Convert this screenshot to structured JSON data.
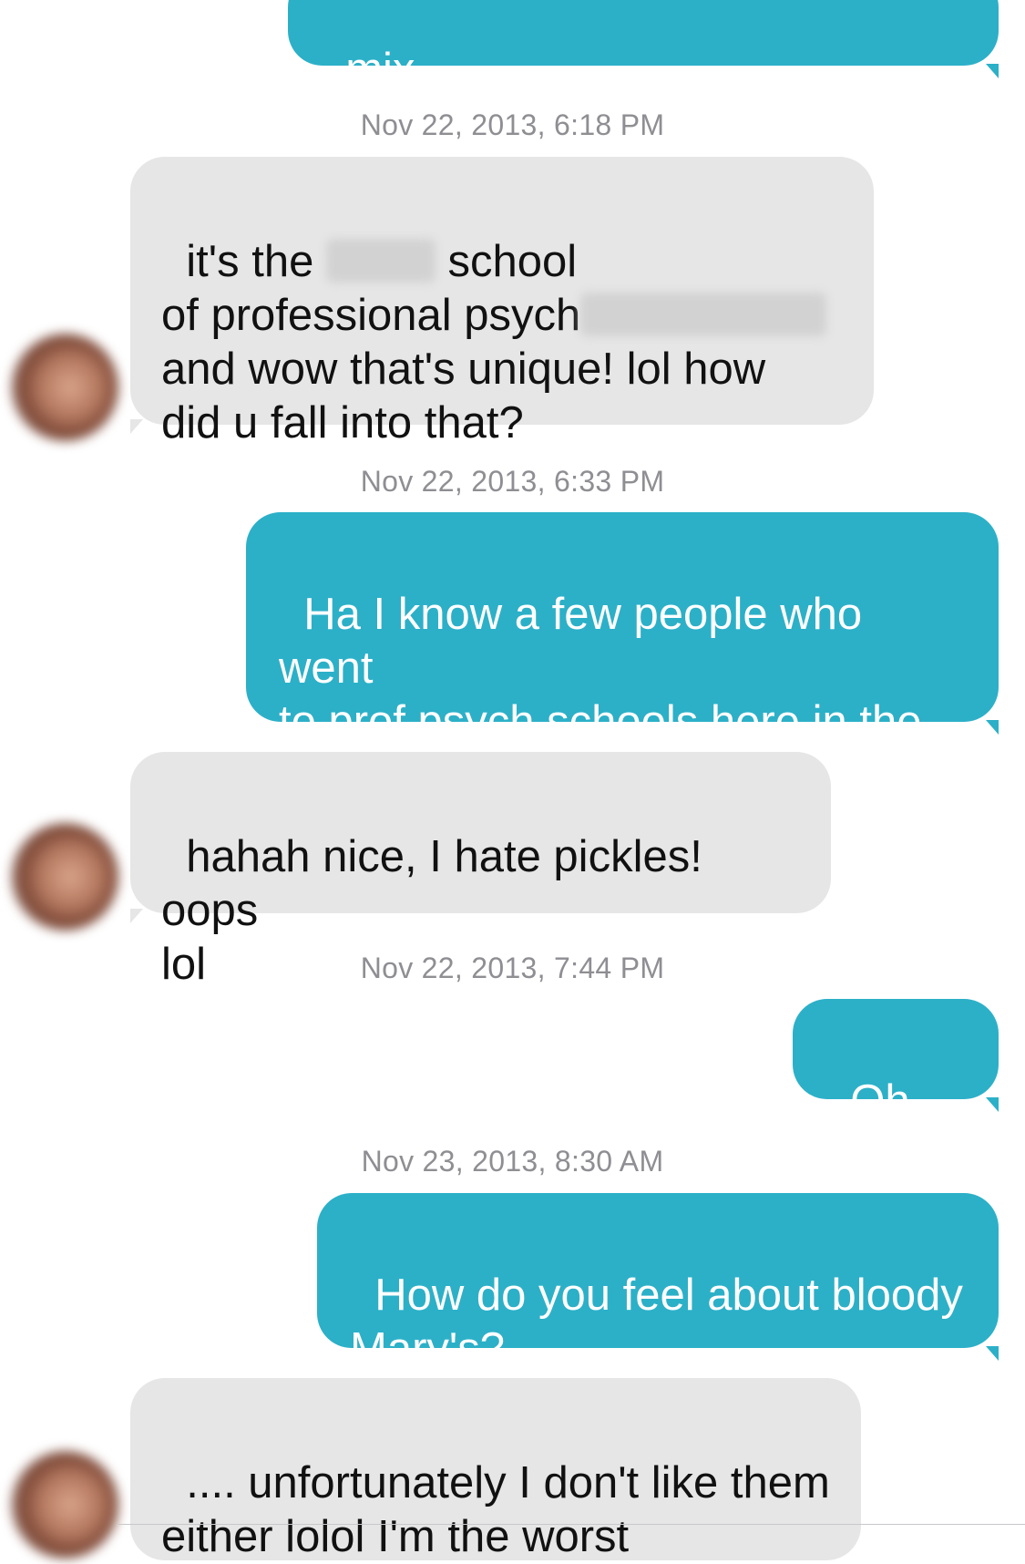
{
  "thread": {
    "colors": {
      "incoming_bubble": "#e6e6e6",
      "outgoing_bubble": "#2cb0c8",
      "timestamp": "#8e8e93"
    },
    "items": [
      {
        "kind": "message",
        "direction": "outgoing",
        "text": "mix."
      },
      {
        "kind": "timestamp",
        "text": "Nov 22, 2013, 6:18 PM"
      },
      {
        "kind": "message",
        "direction": "incoming",
        "avatar": "blurred-contact-photo",
        "parts": [
          "it's the ",
          " school\nof professional psych",
          "\nand wow that's unique! lol how\ndid u fall into that?"
        ]
      },
      {
        "kind": "timestamp",
        "text": "Nov 22, 2013, 6:33 PM"
      },
      {
        "kind": "message",
        "direction": "outgoing",
        "text": "Ha I know a few people who went\nto prof psych schools here in the\ncity!  I love pickles :)"
      },
      {
        "kind": "message",
        "direction": "incoming",
        "avatar": "blurred-contact-photo",
        "text": "hahah nice, I hate pickles! oops\nlol"
      },
      {
        "kind": "timestamp",
        "text": "Nov 22, 2013, 7:44 PM"
      },
      {
        "kind": "message",
        "direction": "outgoing",
        "text": "Oh no!"
      },
      {
        "kind": "timestamp",
        "text": "Nov 23, 2013, 8:30 AM"
      },
      {
        "kind": "message",
        "direction": "outgoing",
        "text": "How do you feel about bloody\nMary's?"
      },
      {
        "kind": "message",
        "direction": "incoming",
        "avatar": "blurred-contact-photo",
        "text": ".... unfortunately I don't like them\neither lolol I'm the worst"
      }
    ]
  }
}
